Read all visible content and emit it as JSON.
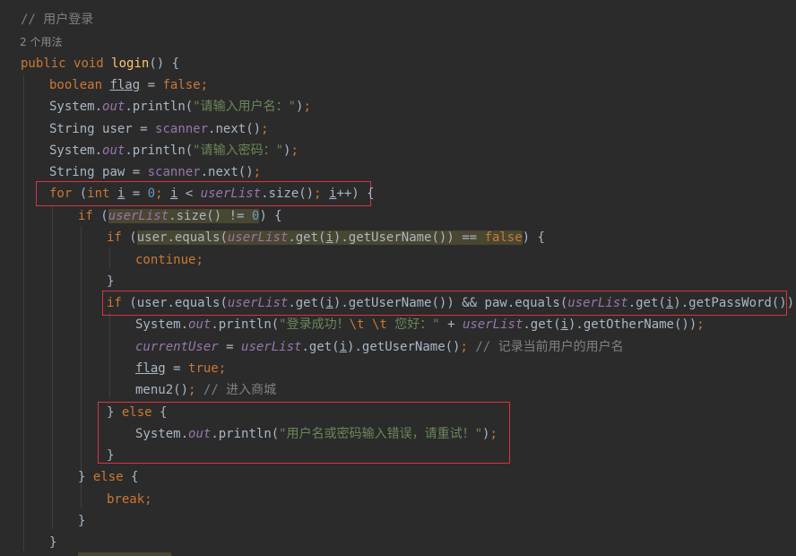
{
  "code": {
    "comment_header": "// 用户登录",
    "usages_hint": "2 个用法",
    "sig_public": "public",
    "sig_void": "void",
    "sig_name": "login",
    "sig_rest": "() {",
    "kw_boolean": "boolean",
    "var_flag": "flag",
    "kw_false": "false",
    "system": "System",
    "out": "out",
    "println": ".println(",
    "str_user_prompt": "\"请输入用户名：\"",
    "str_pwd_prompt": "\"请输入密码：\"",
    "string_type": "String",
    "var_user": "user",
    "var_paw": "paw",
    "scanner": "scanner",
    "next_call": ".next()",
    "kw_for": "for",
    "kw_int": "int",
    "var_i": "i",
    "num_0": "0",
    "userlist": "userList",
    "size_call": ".size()",
    "kw_if": "if",
    "kw_continue": "continue",
    "equals_call": ".equals(",
    "get_call": ".get(",
    "get_username": ".getUserName()",
    "get_password": ".getPassWord()",
    "get_othername": ".getOtherName()",
    "str_login_ok_a": "\"登录成功！",
    "esc_t": "\\t",
    "str_login_ok_b": "您好：\"",
    "current_user": "currentUser",
    "comment_record": "// 记录当前用户的用户名",
    "kw_true": "true",
    "menu2": "menu2",
    "comment_mall": "// 进入商城",
    "kw_else": "else",
    "str_error": "\"用户名或密码输入错误，请重试！\"",
    "kw_break": "break"
  }
}
